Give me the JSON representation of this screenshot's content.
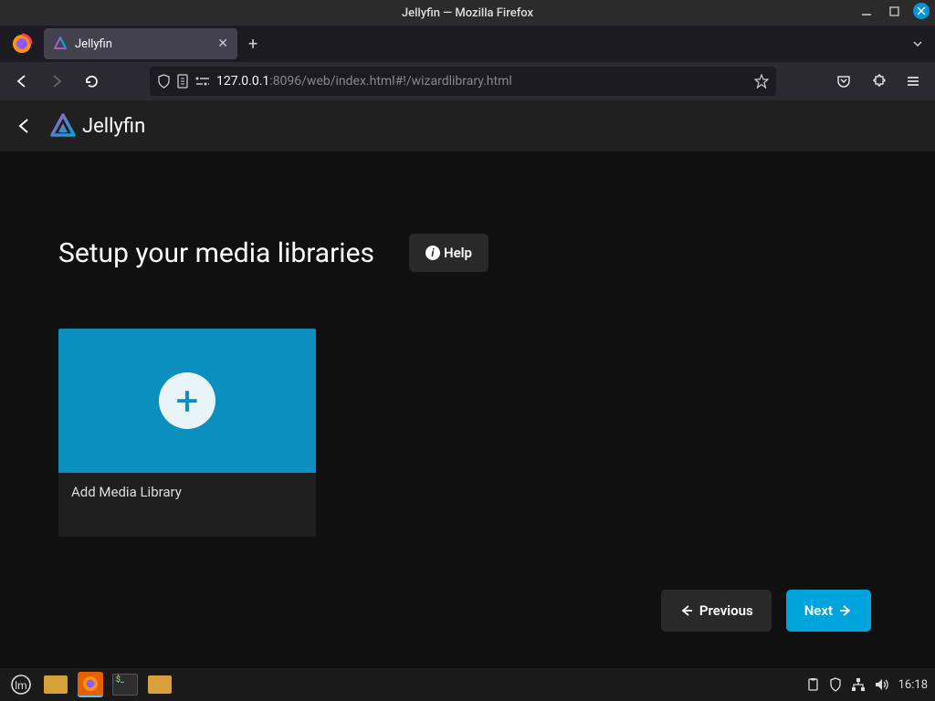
{
  "window": {
    "title": "Jellyfin — Mozilla Firefox"
  },
  "browser": {
    "tab_title": "Jellyfin",
    "url_host": "127.0.0.1",
    "url_path": ":8096/web/index.html#!/wizardlibrary.html"
  },
  "app": {
    "name": "Jellyfin",
    "heading": "Setup your media libraries",
    "help_label": "Help",
    "card_label": "Add Media Library",
    "prev_label": "Previous",
    "next_label": "Next"
  },
  "taskbar": {
    "time": "16:18"
  }
}
